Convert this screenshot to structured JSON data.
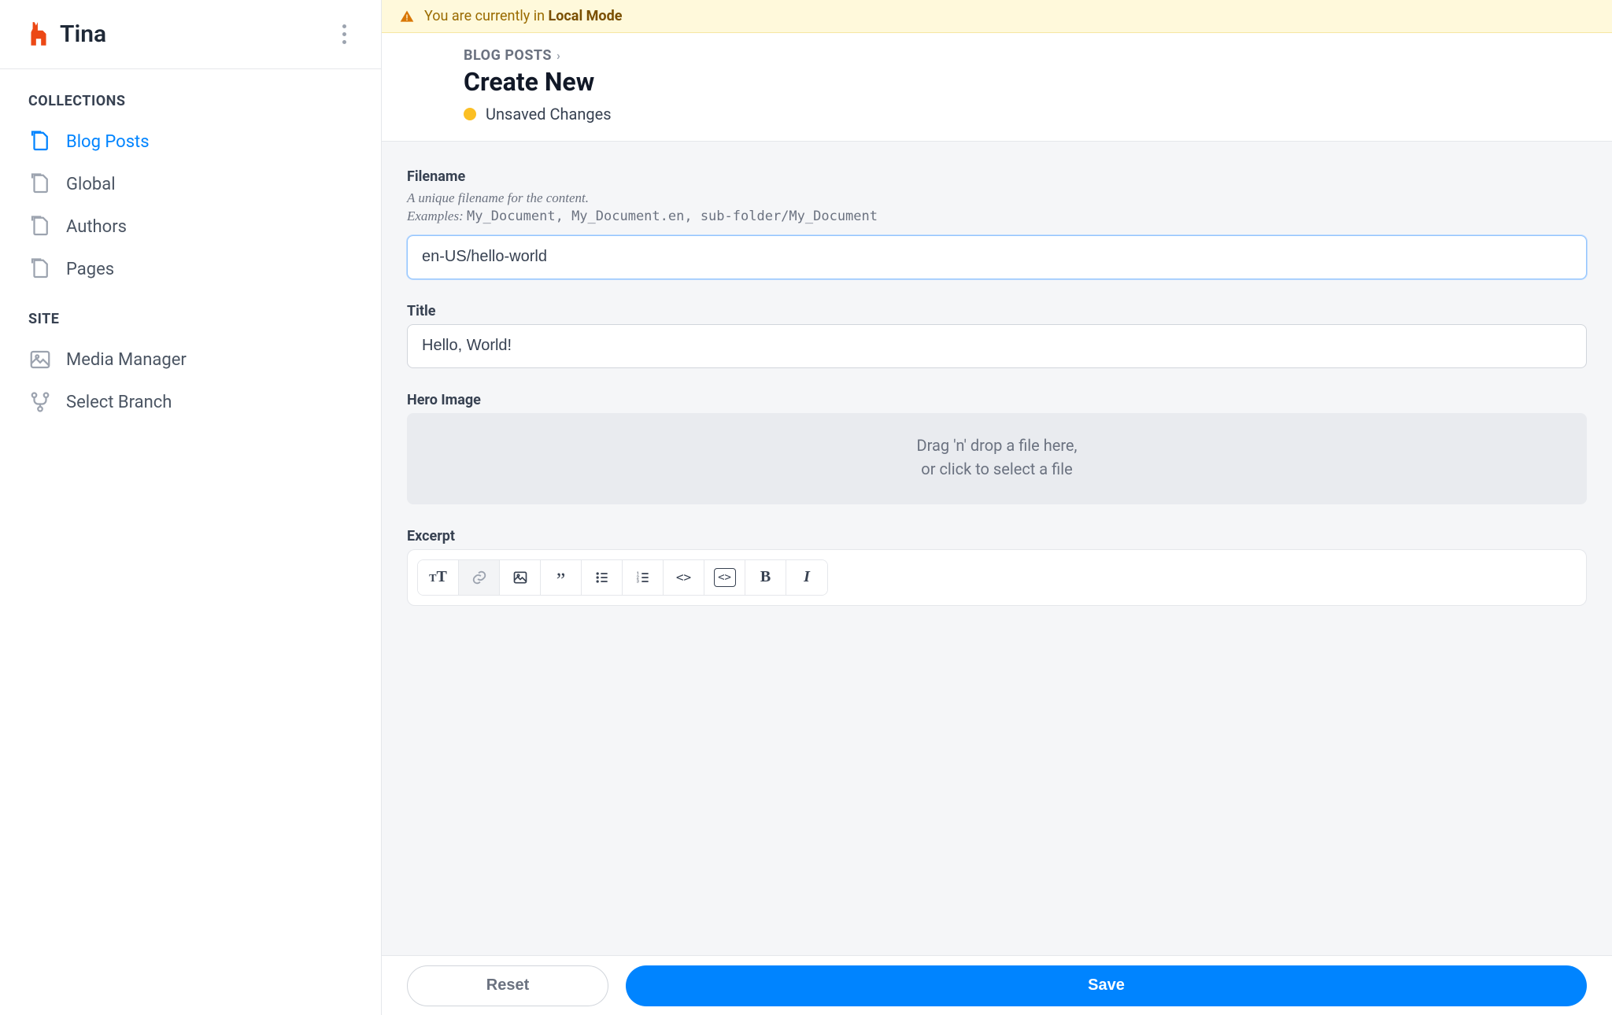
{
  "brand": {
    "name": "Tina"
  },
  "banner": {
    "prefix": "You are currently in ",
    "mode": "Local Mode"
  },
  "breadcrumb": {
    "parent": "BLOG POSTS"
  },
  "page": {
    "title": "Create New",
    "status": "Unsaved Changes",
    "status_color": "#fbbf24"
  },
  "sidebar": {
    "section_collections": "COLLECTIONS",
    "section_site": "SITE",
    "collections": [
      {
        "label": "Blog Posts",
        "active": true
      },
      {
        "label": "Global"
      },
      {
        "label": "Authors"
      },
      {
        "label": "Pages"
      }
    ],
    "site": [
      {
        "label": "Media Manager",
        "icon": "image"
      },
      {
        "label": "Select Branch",
        "icon": "branch"
      }
    ]
  },
  "form": {
    "filename": {
      "label": "Filename",
      "desc": "A unique filename for the content.",
      "examples_prefix": "Examples: ",
      "examples": "My_Document, My_Document.en, sub-folder/My_Document",
      "value": "en-US/hello-world"
    },
    "title": {
      "label": "Title",
      "value": "Hello, World!"
    },
    "hero": {
      "label": "Hero Image",
      "drop_line1": "Drag 'n' drop a file here,",
      "drop_line2": "or click to select a file"
    },
    "excerpt": {
      "label": "Excerpt"
    }
  },
  "rte_buttons": [
    {
      "name": "heading",
      "glyph": "tT"
    },
    {
      "name": "link",
      "glyph": "link",
      "disabled": true
    },
    {
      "name": "image",
      "glyph": "image"
    },
    {
      "name": "quote",
      "glyph": "”"
    },
    {
      "name": "ul",
      "glyph": "ul"
    },
    {
      "name": "ol",
      "glyph": "ol"
    },
    {
      "name": "code-inline",
      "glyph": "<>"
    },
    {
      "name": "code-block",
      "glyph": "<>",
      "boxed": true
    },
    {
      "name": "bold",
      "glyph": "B"
    },
    {
      "name": "italic",
      "glyph": "I"
    }
  ],
  "footer": {
    "reset": "Reset",
    "save": "Save"
  }
}
